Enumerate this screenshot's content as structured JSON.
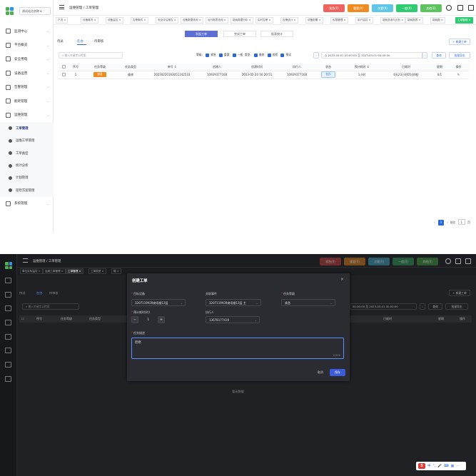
{
  "top": {
    "site_select": "测试站点名称",
    "breadcrumb": "运维管理 / 工单管理",
    "alarms": [
      {
        "label": "紧急(0)",
        "color": "#f0625c"
      },
      {
        "label": "重要(0)",
        "color": "#f28b1f"
      },
      {
        "label": "次要(0)",
        "color": "#5ec6e6"
      },
      {
        "label": "一般(0)",
        "color": "#2ecc71"
      },
      {
        "label": "其他(0)",
        "color": "#5cc45c"
      }
    ],
    "tabs": [
      "户况",
      "设备概况",
      "设备监控",
      "告警事件",
      "安全评估报告",
      "设备数据查询",
      "运行报表查询",
      "能耗数据分析",
      "实时告警",
      "告警统计",
      "设备配置",
      "权限管理",
      "用户监控",
      "能耗查询与分析",
      "能耗报表",
      "能耗图",
      "工单管理"
    ],
    "nav": [
      {
        "label": "监测中心",
        "type": "item"
      },
      {
        "label": "平台概览",
        "type": "item"
      },
      {
        "label": "安全用电",
        "type": "item"
      },
      {
        "label": "设备运营",
        "type": "item"
      },
      {
        "label": "告警管理",
        "type": "item"
      },
      {
        "label": "能耗管理",
        "type": "item"
      },
      {
        "label": "运维管理",
        "type": "item"
      },
      {
        "label": "工单管理",
        "type": "sub",
        "active": true
      },
      {
        "label": "运维工单管理",
        "type": "sub"
      },
      {
        "label": "工单类型",
        "type": "sub"
      },
      {
        "label": "统计分析",
        "type": "sub"
      },
      {
        "label": "计划管理",
        "type": "sub"
      },
      {
        "label": "巡检方案管理",
        "type": "sub"
      },
      {
        "label": "系统管理",
        "type": "item"
      }
    ],
    "segments": [
      "发起工单",
      "完成工单",
      "报表统计"
    ],
    "subtabs": [
      "待派",
      "在办",
      "待审核"
    ],
    "new_button": "+ 新建工单",
    "search_placeholder": "输入关键字以检索",
    "filter_level_label": "等级:",
    "filter_levels": [
      "紧急",
      "重要",
      "一般"
    ],
    "filter_type_label": "类型:",
    "filter_types": [
      "维修",
      "巡检",
      "预试"
    ],
    "date_start": "2023-02-01 00:00:00",
    "date_sep": "至",
    "date_end": "2023-03-01 00:00:00",
    "query_button": "查询",
    "export_button": "批量导出",
    "columns": [
      "",
      "序号",
      "任务等级",
      "任务类型",
      "单号 ⇕",
      "创建人",
      "创建时间",
      "执行人",
      "状态",
      "预计耗时 ⇕",
      "已耗时",
      "星期",
      "操作"
    ],
    "rows": [
      {
        "no": "1",
        "level": "紧急",
        "type": "维修",
        "order": "20230220163051142533",
        "creator": "10929377168",
        "created": "2023-02-20 16:20:51",
        "executor": "10929377168",
        "status": "在办",
        "estimate": "1小时",
        "elapsed": "6天23小时05分9秒",
        "week": "0/1",
        "op": "✎"
      }
    ],
    "pager": {
      "prev": "‹",
      "page": "1",
      "next": "›",
      "goto": "前往",
      "goto_value": "1",
      "unit": "页"
    }
  },
  "bottom": {
    "breadcrumb": "运维管理 / 工单管理",
    "alarms": [
      {
        "label": "紧急(0)",
        "color": "#b23b36"
      },
      {
        "label": "重要(0)",
        "color": "#c77116"
      },
      {
        "label": "次要(0)",
        "color": "#3a93ad"
      },
      {
        "label": "一般(0)",
        "color": "#2b8d52"
      },
      {
        "label": "其他(0)",
        "color": "#3a8d3a"
      }
    ],
    "tabs": [
      "单位实际监控",
      "运维工单管理",
      "工单管理",
      "工单类型",
      "能"
    ],
    "subtabs": [
      "待派",
      "在办",
      "待审核"
    ],
    "search_placeholder": "输入关键字以检索",
    "new_button": "+ 新建工单",
    "date_start": "00:00:00",
    "date_sep": "至",
    "date_end": "2023-03-01 00:00:00",
    "query_button": "查询",
    "export_button": "批量导出",
    "columns": [
      "序号",
      "任务等级",
      "任务类型",
      "已耗时",
      "星期",
      "操作"
    ],
    "empty": "暂无数据",
    "ime": [
      "中",
      "°,",
      "🎤",
      "⌨",
      "▦",
      "⋯"
    ]
  },
  "modal": {
    "title": "创建工单",
    "close": "×",
    "device_label": "目标设备",
    "device_value": "3207119939商场楼13层",
    "event_label": "关联事件",
    "event_value": "3207119939商场楼13层 主",
    "level_label": "任务等级",
    "level_value": "紧急",
    "duration_label": "预计耗时(时)",
    "duration_value": "1",
    "minus": "−",
    "plus": "+",
    "executor_label": "执行人",
    "executor_value": "13678177419",
    "desc_label": "任务描述",
    "desc_value": "检修",
    "desc_count": "2/300",
    "cancel": "取消",
    "save": "保存"
  }
}
